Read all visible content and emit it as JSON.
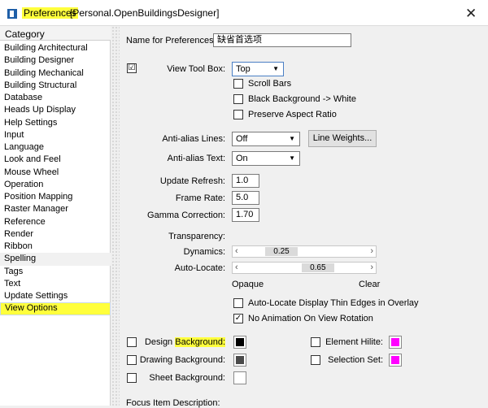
{
  "window": {
    "title_main": "Preferences",
    "title_rest": "[Personal.OpenBuildingsDesigner]",
    "close_glyph": "✕"
  },
  "category": {
    "header": "Category",
    "items": [
      "Building Architectural",
      "Building Designer",
      "Building Mechanical",
      "Building Structural",
      "Database",
      "Heads Up Display",
      "Help Settings",
      "Input",
      "Language",
      "Look and Feel",
      "Mouse Wheel",
      "Operation",
      "Position Mapping",
      "Raster Manager",
      "Reference",
      "Render",
      "Ribbon",
      "Spelling",
      "Tags",
      "Text",
      "Update Settings",
      "View Options"
    ],
    "selected": "View Options"
  },
  "form": {
    "name_label": "Name for Preferences:",
    "name_value": "缺省首选项",
    "view_toolbox_label": "View Tool Box:",
    "view_toolbox_value": "Top",
    "view_toolbox_checked": "☑",
    "scroll_bars": "Scroll Bars",
    "black_background": "Black Background -> White",
    "preserve_aspect": "Preserve Aspect Ratio",
    "antialias_lines_label": "Anti-alias Lines:",
    "antialias_lines_value": "Off",
    "line_weights_button": "Line Weights...",
    "antialias_text_label": "Anti-alias Text:",
    "antialias_text_value": "On",
    "update_refresh_label": "Update Refresh:",
    "update_refresh_value": "1.0",
    "frame_rate_label": "Frame Rate:",
    "frame_rate_value": "5.0",
    "gamma_label": "Gamma Correction:",
    "gamma_value": "1.70",
    "transparency_label": "Transparency:",
    "dynamics_label": "Dynamics:",
    "dynamics_value": "0.25",
    "dynamics_level": 0.25,
    "autolocate_label": "Auto-Locate:",
    "autolocate_value": "0.65",
    "autolocate_level": 0.65,
    "opaque_label": "Opaque",
    "clear_label": "Clear",
    "autolocate_thin_edges": "Auto-Locate Display Thin Edges in Overlay",
    "no_animation": "No Animation On View Rotation",
    "no_animation_checked": "✓",
    "design_background_prefix": "Design ",
    "design_background_highlight": "Background:",
    "design_background_color": "#000000",
    "drawing_background_label": "Drawing Background:",
    "drawing_background_color": "#4a4a4a",
    "sheet_background_label": "Sheet Background:",
    "sheet_background_color": "#ffffff",
    "element_hilite_label": "Element Hilite:",
    "element_hilite_color": "#ff00ff",
    "selection_set_label": "Selection Set:",
    "selection_set_color": "#ff00ff",
    "focus_item_label": "Focus Item Description:"
  },
  "icons": {
    "slider_left": "‹",
    "slider_right": "›",
    "combo_arrow": "▼"
  }
}
